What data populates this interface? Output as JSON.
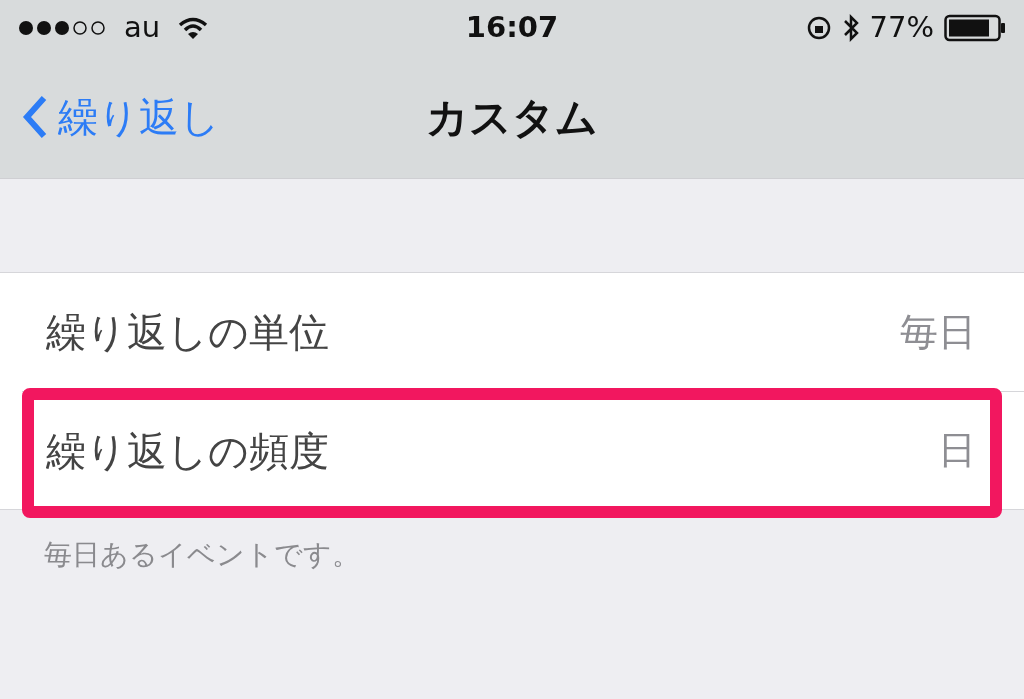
{
  "status_bar": {
    "carrier": "au",
    "time": "16:07",
    "battery": "77%"
  },
  "nav_bar": {
    "back": "繰り返し",
    "title": "カスタム"
  },
  "rows": [
    {
      "label": "繰り返しの単位",
      "value": "毎日",
      "highlighted": false
    },
    {
      "label": "繰り返しの頻度",
      "value": "日",
      "highlighted": true
    }
  ],
  "footer": "毎日あるイベントです。"
}
